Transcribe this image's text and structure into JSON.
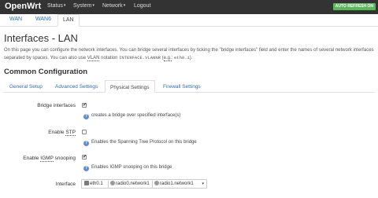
{
  "navbar": {
    "brand": "OpenWrt",
    "menu": [
      {
        "label": "Status"
      },
      {
        "label": "System"
      },
      {
        "label": "Network"
      },
      {
        "label": "Logout"
      }
    ],
    "auto_refresh": "AUTO REFRESH ON"
  },
  "subtabs": [
    "WAN",
    "WAN6",
    "LAN"
  ],
  "page": {
    "title": "Interfaces - LAN",
    "description_part1": "On this page you can configure the network interfaces. You can bridge several interfaces by ticking the \"bridge interfaces\" field and enter the names of several network interfaces separated by spaces. You can also use ",
    "vlan_abbr": "VLAN",
    "description_part2": " notation ",
    "notation_code": "INTERFACE.VLANNR",
    "description_part3": " (",
    "eg_abbr": "e.g.",
    "description_part4": ": ",
    "example_code": "eth0.1",
    "description_part5": ")."
  },
  "section": {
    "title": "Common Configuration",
    "tabs": [
      "General Setup",
      "Advanced Settings",
      "Physical Settings",
      "Firewall Settings"
    ],
    "active_tab": "Physical Settings"
  },
  "form": {
    "bridge": {
      "label": "Bridge interfaces",
      "checked": true,
      "check_glyph": "✔",
      "help": "creates a bridge over specified interface(s)"
    },
    "stp": {
      "label_prefix": "Enable ",
      "label_abbr": "STP",
      "checked": false,
      "help": "Enables the Spanning Tree Protocol on this bridge"
    },
    "igmp": {
      "label_prefix": "Enable ",
      "label_abbr": "IGMP",
      "label_suffix": " snooping",
      "checked": true,
      "check_glyph": "✔",
      "help": "Enables IGMP snooping on this bridge"
    },
    "interface": {
      "label": "Interface",
      "selected": [
        "eth0.1",
        "radio0.network1",
        "radio1.network1"
      ],
      "caret": "▾"
    }
  },
  "help_glyph": "?",
  "caret_glyph": "▾"
}
